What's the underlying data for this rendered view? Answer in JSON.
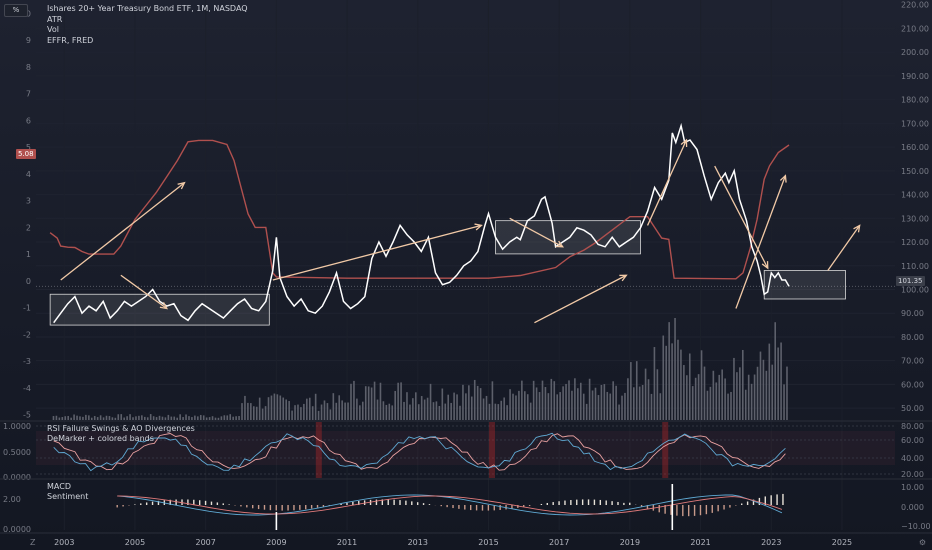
{
  "header": {
    "percent_button": "%",
    "title": "Ishares 20+ Year Treasury Bond ETF, 1M, NASDAQ",
    "indicators": [
      "ATR",
      "Vol",
      "EFFR, FRED"
    ]
  },
  "badges": {
    "effr_value": "5.08",
    "price_value": "101.35"
  },
  "panes": {
    "oscillator_titles": [
      "RSI Failure Swings & AO Divergences",
      "DeMarker + colored bands"
    ],
    "macd_titles": [
      "MACD",
      "Sentiment"
    ],
    "corner_label": "Z",
    "footer_icon": "settings-icon"
  },
  "colors": {
    "background": "#131722",
    "price_line": "#ffffff",
    "effr_line": "#b0504e",
    "arrows": "#f1c9a6",
    "volume": "#5d606b",
    "badge_red": "#b0504e",
    "badge_gray": "#3a3e49"
  },
  "chart_data": {
    "type": "line",
    "x_ticks": [
      "2003",
      "2005",
      "2007",
      "2009",
      "2011",
      "2013",
      "2015",
      "2017",
      "2019",
      "2021",
      "2023",
      "2025"
    ],
    "x_range": [
      2002.2,
      2026.5
    ],
    "price_axis": {
      "ticks": [
        "220.00",
        "210.00",
        "200.00",
        "190.00",
        "180.00",
        "170.00",
        "160.00",
        "150.00",
        "140.00",
        "130.00",
        "120.00",
        "110.00",
        "100.00",
        "90.00",
        "80.00",
        "70.00",
        "60.00",
        "50.00"
      ],
      "range": [
        45,
        222
      ]
    },
    "left_axis": {
      "ticks": [
        "10",
        "9",
        "8",
        "7",
        "6",
        "5",
        "4",
        "3",
        "2",
        "1",
        "0",
        "-1",
        "-2",
        "-3",
        "-4",
        "-5"
      ],
      "range": [
        -5.2,
        10.5
      ]
    },
    "series": [
      {
        "key": "tlt",
        "points": [
          [
            2002.7,
            86
          ],
          [
            2002.9,
            90
          ],
          [
            2003.1,
            94
          ],
          [
            2003.3,
            97
          ],
          [
            2003.5,
            90
          ],
          [
            2003.7,
            93
          ],
          [
            2003.9,
            91
          ],
          [
            2004.1,
            95
          ],
          [
            2004.3,
            88
          ],
          [
            2004.5,
            91
          ],
          [
            2004.7,
            95
          ],
          [
            2004.9,
            93
          ],
          [
            2005.1,
            95
          ],
          [
            2005.3,
            97
          ],
          [
            2005.5,
            100
          ],
          [
            2005.7,
            95
          ],
          [
            2005.9,
            93
          ],
          [
            2006.1,
            94
          ],
          [
            2006.3,
            89
          ],
          [
            2006.5,
            87
          ],
          [
            2006.7,
            91
          ],
          [
            2006.9,
            94
          ],
          [
            2007.1,
            92
          ],
          [
            2007.3,
            90
          ],
          [
            2007.5,
            88
          ],
          [
            2007.7,
            91
          ],
          [
            2007.9,
            94
          ],
          [
            2008.1,
            96
          ],
          [
            2008.3,
            92
          ],
          [
            2008.5,
            91
          ],
          [
            2008.7,
            95
          ],
          [
            2008.9,
            108
          ],
          [
            2009.0,
            122
          ],
          [
            2009.1,
            105
          ],
          [
            2009.3,
            97
          ],
          [
            2009.5,
            93
          ],
          [
            2009.7,
            96
          ],
          [
            2009.9,
            91
          ],
          [
            2010.1,
            90
          ],
          [
            2010.3,
            93
          ],
          [
            2010.5,
            99
          ],
          [
            2010.7,
            107
          ],
          [
            2010.9,
            95
          ],
          [
            2011.1,
            92
          ],
          [
            2011.3,
            94
          ],
          [
            2011.5,
            97
          ],
          [
            2011.7,
            113
          ],
          [
            2011.9,
            120
          ],
          [
            2012.1,
            114
          ],
          [
            2012.3,
            120
          ],
          [
            2012.5,
            127
          ],
          [
            2012.7,
            123
          ],
          [
            2012.9,
            120
          ],
          [
            2013.1,
            116
          ],
          [
            2013.3,
            122
          ],
          [
            2013.5,
            107
          ],
          [
            2013.7,
            102
          ],
          [
            2013.9,
            103
          ],
          [
            2014.1,
            106
          ],
          [
            2014.3,
            110
          ],
          [
            2014.5,
            112
          ],
          [
            2014.7,
            116
          ],
          [
            2014.9,
            127
          ],
          [
            2015.0,
            132
          ],
          [
            2015.2,
            122
          ],
          [
            2015.4,
            117
          ],
          [
            2015.6,
            120
          ],
          [
            2015.8,
            122
          ],
          [
            2015.9,
            121
          ],
          [
            2016.1,
            129
          ],
          [
            2016.3,
            131
          ],
          [
            2016.5,
            138
          ],
          [
            2016.6,
            139
          ],
          [
            2016.8,
            128
          ],
          [
            2016.9,
            118
          ],
          [
            2017.1,
            120
          ],
          [
            2017.3,
            122
          ],
          [
            2017.5,
            126
          ],
          [
            2017.7,
            125
          ],
          [
            2017.9,
            123
          ],
          [
            2018.1,
            119
          ],
          [
            2018.3,
            118
          ],
          [
            2018.5,
            122
          ],
          [
            2018.7,
            118
          ],
          [
            2018.9,
            120
          ],
          [
            2019.1,
            122
          ],
          [
            2019.3,
            126
          ],
          [
            2019.5,
            133
          ],
          [
            2019.7,
            143
          ],
          [
            2019.9,
            138
          ],
          [
            2020.1,
            146
          ],
          [
            2020.2,
            166
          ],
          [
            2020.3,
            162
          ],
          [
            2020.45,
            169
          ],
          [
            2020.55,
            162
          ],
          [
            2020.7,
            163
          ],
          [
            2020.9,
            159
          ],
          [
            2021.1,
            148
          ],
          [
            2021.3,
            138
          ],
          [
            2021.5,
            145
          ],
          [
            2021.7,
            149
          ],
          [
            2021.8,
            145
          ],
          [
            2021.95,
            150
          ],
          [
            2022.1,
            138
          ],
          [
            2022.3,
            129
          ],
          [
            2022.45,
            118
          ],
          [
            2022.6,
            112
          ],
          [
            2022.7,
            106
          ],
          [
            2022.8,
            98
          ],
          [
            2022.9,
            99
          ],
          [
            2023.0,
            107
          ],
          [
            2023.1,
            105
          ],
          [
            2023.2,
            107
          ],
          [
            2023.3,
            104
          ],
          [
            2023.4,
            104
          ],
          [
            2023.5,
            101.35
          ]
        ]
      },
      {
        "key": "effr",
        "points": [
          [
            2002.6,
            1.8
          ],
          [
            2002.8,
            1.6
          ],
          [
            2002.9,
            1.3
          ],
          [
            2003.1,
            1.26
          ],
          [
            2003.3,
            1.25
          ],
          [
            2003.5,
            1.1
          ],
          [
            2003.7,
            1.0
          ],
          [
            2004.0,
            1.0
          ],
          [
            2004.4,
            1.0
          ],
          [
            2004.6,
            1.3
          ],
          [
            2004.8,
            1.8
          ],
          [
            2005.0,
            2.3
          ],
          [
            2005.3,
            2.8
          ],
          [
            2005.6,
            3.3
          ],
          [
            2005.9,
            3.9
          ],
          [
            2006.2,
            4.5
          ],
          [
            2006.5,
            5.2
          ],
          [
            2006.8,
            5.25
          ],
          [
            2007.2,
            5.25
          ],
          [
            2007.6,
            5.1
          ],
          [
            2007.8,
            4.5
          ],
          [
            2008.0,
            3.5
          ],
          [
            2008.2,
            2.5
          ],
          [
            2008.4,
            2.0
          ],
          [
            2008.7,
            2.0
          ],
          [
            2008.9,
            0.3
          ],
          [
            2009.0,
            0.15
          ],
          [
            2011.0,
            0.1
          ],
          [
            2013.0,
            0.1
          ],
          [
            2015.0,
            0.1
          ],
          [
            2015.9,
            0.2
          ],
          [
            2016.9,
            0.5
          ],
          [
            2017.3,
            0.9
          ],
          [
            2017.7,
            1.15
          ],
          [
            2018.0,
            1.4
          ],
          [
            2018.4,
            1.8
          ],
          [
            2018.8,
            2.2
          ],
          [
            2019.0,
            2.4
          ],
          [
            2019.5,
            2.4
          ],
          [
            2019.7,
            2.0
          ],
          [
            2019.9,
            1.6
          ],
          [
            2020.1,
            1.55
          ],
          [
            2020.25,
            0.1
          ],
          [
            2022.0,
            0.08
          ],
          [
            2022.2,
            0.3
          ],
          [
            2022.4,
            1.2
          ],
          [
            2022.6,
            2.3
          ],
          [
            2022.8,
            3.8
          ],
          [
            2022.95,
            4.3
          ],
          [
            2023.2,
            4.8
          ],
          [
            2023.5,
            5.08
          ]
        ]
      }
    ]
  }
}
